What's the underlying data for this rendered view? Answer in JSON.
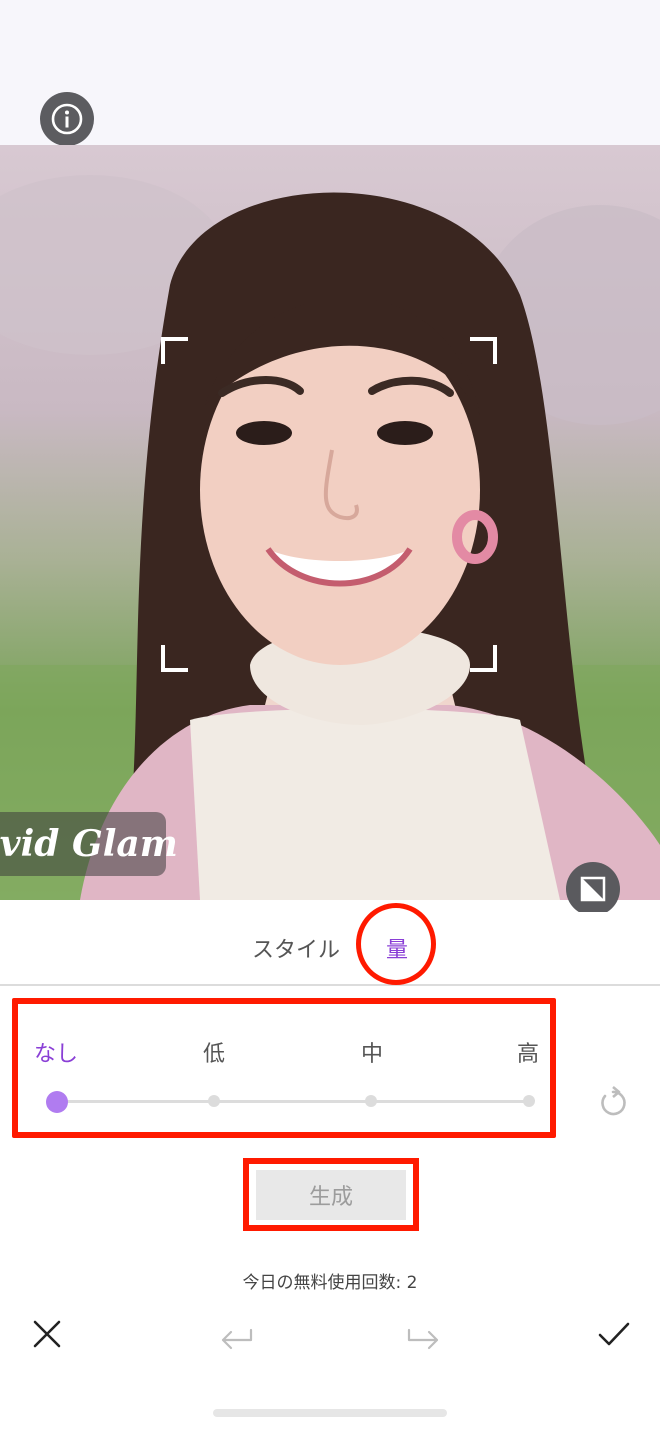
{
  "photo": {
    "watermark_text": "ivid Glam"
  },
  "tabs": [
    {
      "label": "スタイル"
    },
    {
      "label": "量"
    }
  ],
  "levels": {
    "labels": [
      "なし",
      "低",
      "中",
      "高"
    ],
    "selected": "なし"
  },
  "actions": {
    "generate_label": "生成"
  },
  "footer": {
    "free_usage_text": "今日の無料使用回数: 2"
  },
  "icons": {
    "info": "info-icon",
    "compare": "compare-icon",
    "reset": "reset-icon",
    "close": "close-icon",
    "undo": "undo-icon",
    "redo": "redo-icon",
    "confirm": "check-icon"
  },
  "colors": {
    "accent": "#8a3fd6",
    "slider_knob": "#b07cf0",
    "highlight": "#ff1a00"
  }
}
